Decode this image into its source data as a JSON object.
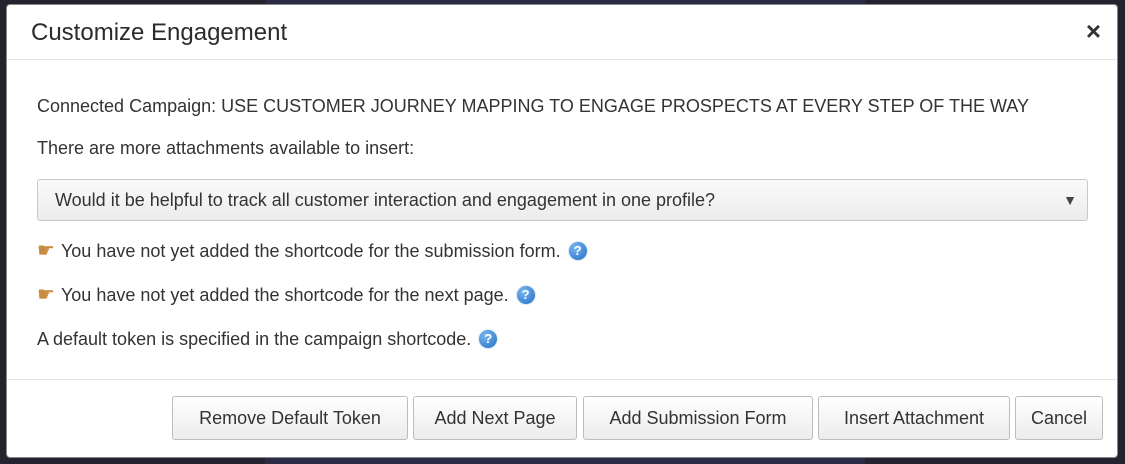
{
  "dialog": {
    "title": "Customize Engagement",
    "close_symbol": "×"
  },
  "body": {
    "campaign_text": "Connected Campaign: USE CUSTOMER JOURNEY MAPPING TO ENGAGE PROSPECTS AT EVERY STEP OF THE WAY",
    "attachments_text": "There are more attachments available to insert:",
    "attachment_select": {
      "selected": "Would it be helpful to track all customer interaction and engagement in one profile?",
      "caret": "▼"
    },
    "notices": [
      {
        "icon": "pointing-hand-icon",
        "text": "You have not yet added the shortcode for the submission form."
      },
      {
        "icon": "pointing-hand-icon",
        "text": "You have not yet added the shortcode for the next page."
      },
      {
        "icon": "",
        "text": "A default token is specified in the campaign shortcode."
      }
    ],
    "help_icon_symbol": "?"
  },
  "footer": {
    "remove_default_token": "Remove Default Token",
    "add_next_page": "Add Next Page",
    "add_submission_form": "Add Submission Form",
    "insert_attachment": "Insert Attachment",
    "cancel": "Cancel"
  },
  "colors": {
    "backdrop": "#23222e",
    "help_icon": "#1f6fc4",
    "hand_icon": "#c88a3e"
  }
}
